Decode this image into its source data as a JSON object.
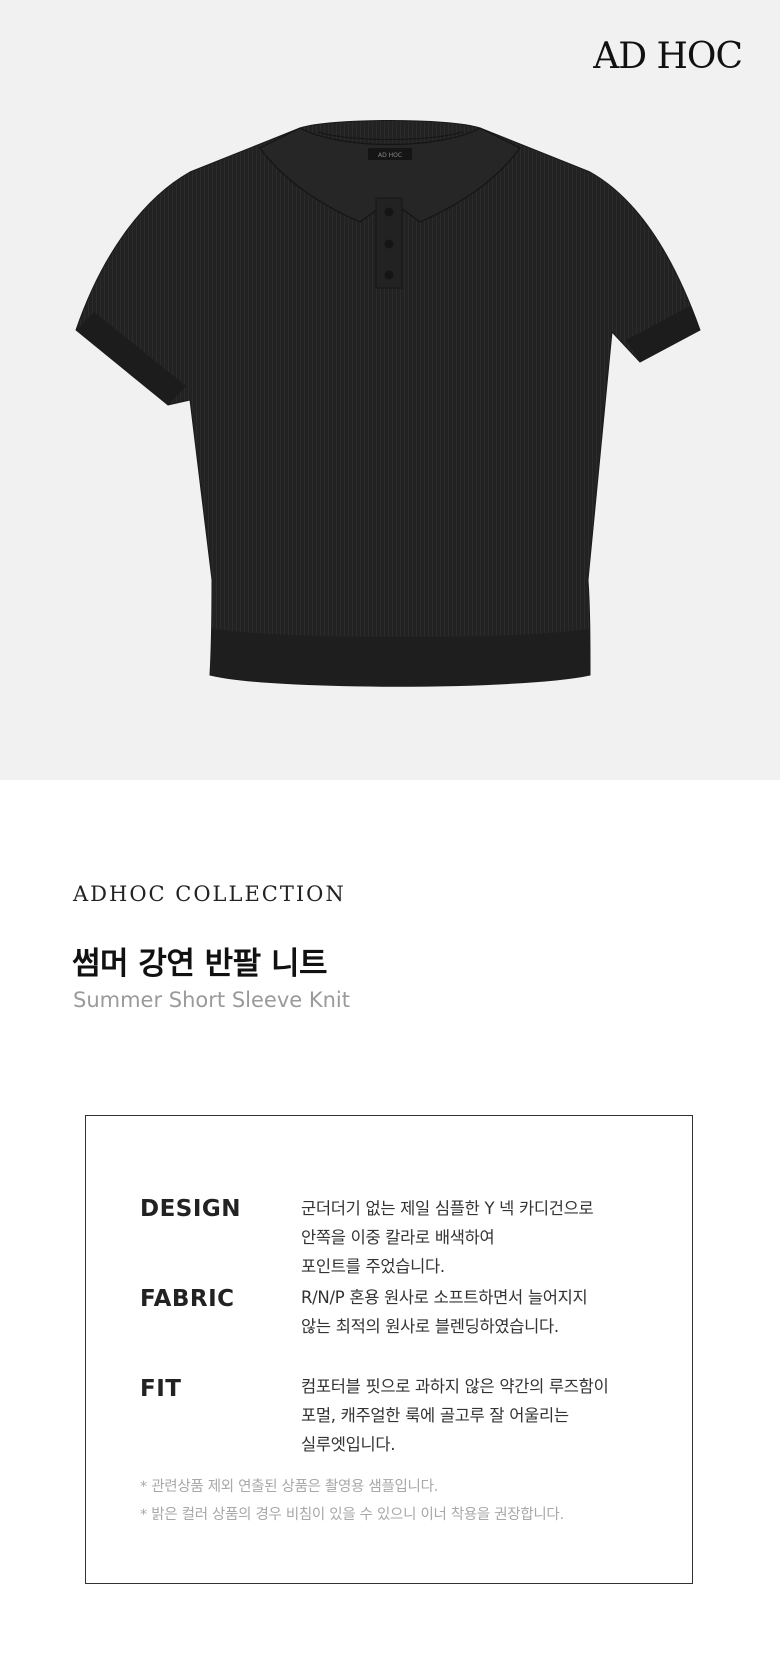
{
  "brand": {
    "logo_text": "AD HOC",
    "shirt_tag_text": "AD HOC"
  },
  "product": {
    "collection": "ADHOC COLLECTION",
    "name_ko": "썸머 강연 반팔 니트",
    "name_en": "Summer Short Sleeve Knit",
    "image_color": "#222222"
  },
  "details": {
    "design": {
      "label": "DESIGN",
      "lines": [
        "군더더기 없는 제일 심플한 Y 넥 카디건으로",
        "안쪽을 이중 칼라로 배색하여",
        "포인트를 주었습니다."
      ]
    },
    "fabric": {
      "label": "FABRIC",
      "lines": [
        "R/N/P 혼용 원사로 소프트하면서 늘어지지",
        "않는 최적의 원사로 블렌딩하였습니다."
      ]
    },
    "fit": {
      "label": "FIT",
      "lines": [
        "컴포터블 핏으로 과하지 않은 약간의 루즈함이",
        "포멀, 캐주얼한 룩에 골고루 잘 어울리는",
        "실루엣입니다."
      ]
    },
    "notes": [
      "* 관련상품 제외 연출된 상품은 촬영용 샘플입니다.",
      "* 밝은 컬러 상품의 경우 비침이 있을 수 있으니 이너 착용을 권장합니다."
    ]
  },
  "colors": {
    "hero_background": "#f1f1f1",
    "accent_text": "#111111",
    "muted_text": "#9a9a9a"
  }
}
